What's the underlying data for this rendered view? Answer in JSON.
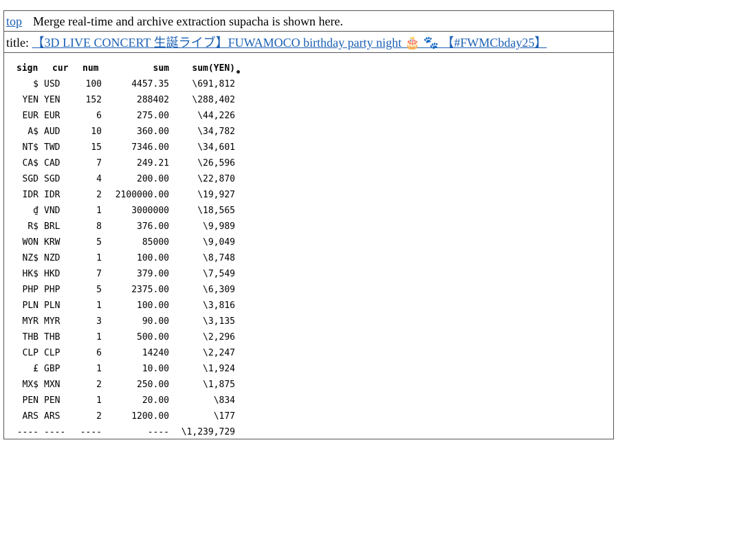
{
  "header": {
    "top_link": "top",
    "message": "Merge real-time and archive extraction supacha is shown here."
  },
  "title_row": {
    "label": "title:",
    "link_text": "【3D LIVE CONCERT 生誕ライブ】FUWAMOCO birthday party night 🎂 🐾 【#FWMCbday25】"
  },
  "table": {
    "columns": [
      "sign",
      "cur",
      "num",
      "sum",
      "sum(YEN)"
    ],
    "rows": [
      [
        "$",
        "USD",
        "100",
        "4457.35",
        "\\691,812"
      ],
      [
        "YEN",
        "YEN",
        "152",
        "288402",
        "\\288,402"
      ],
      [
        "EUR",
        "EUR",
        "6",
        "275.00",
        "\\44,226"
      ],
      [
        "A$",
        "AUD",
        "10",
        "360.00",
        "\\34,782"
      ],
      [
        "NT$",
        "TWD",
        "15",
        "7346.00",
        "\\34,601"
      ],
      [
        "CA$",
        "CAD",
        "7",
        "249.21",
        "\\26,596"
      ],
      [
        "SGD",
        "SGD",
        "4",
        "200.00",
        "\\22,870"
      ],
      [
        "IDR",
        "IDR",
        "2",
        "2100000.00",
        "\\19,927"
      ],
      [
        "₫",
        "VND",
        "1",
        "3000000",
        "\\18,565"
      ],
      [
        "R$",
        "BRL",
        "8",
        "376.00",
        "\\9,989"
      ],
      [
        "WON",
        "KRW",
        "5",
        "85000",
        "\\9,049"
      ],
      [
        "NZ$",
        "NZD",
        "1",
        "100.00",
        "\\8,748"
      ],
      [
        "HK$",
        "HKD",
        "7",
        "379.00",
        "\\7,549"
      ],
      [
        "PHP",
        "PHP",
        "5",
        "2375.00",
        "\\6,309"
      ],
      [
        "PLN",
        "PLN",
        "1",
        "100.00",
        "\\3,816"
      ],
      [
        "MYR",
        "MYR",
        "3",
        "90.00",
        "\\3,135"
      ],
      [
        "THB",
        "THB",
        "1",
        "500.00",
        "\\2,296"
      ],
      [
        "CLP",
        "CLP",
        "6",
        "14240",
        "\\2,247"
      ],
      [
        "£",
        "GBP",
        "1",
        "10.00",
        "\\1,924"
      ],
      [
        "MX$",
        "MXN",
        "2",
        "250.00",
        "\\1,875"
      ],
      [
        "PEN",
        "PEN",
        "1",
        "20.00",
        "\\834"
      ],
      [
        "ARS",
        "ARS",
        "2",
        "1200.00",
        "\\177"
      ]
    ],
    "footer": [
      "----",
      "----",
      "----",
      "----",
      "\\1,239,729"
    ]
  },
  "colors": {
    "link": "#1a5fb4",
    "border": "#555555"
  }
}
